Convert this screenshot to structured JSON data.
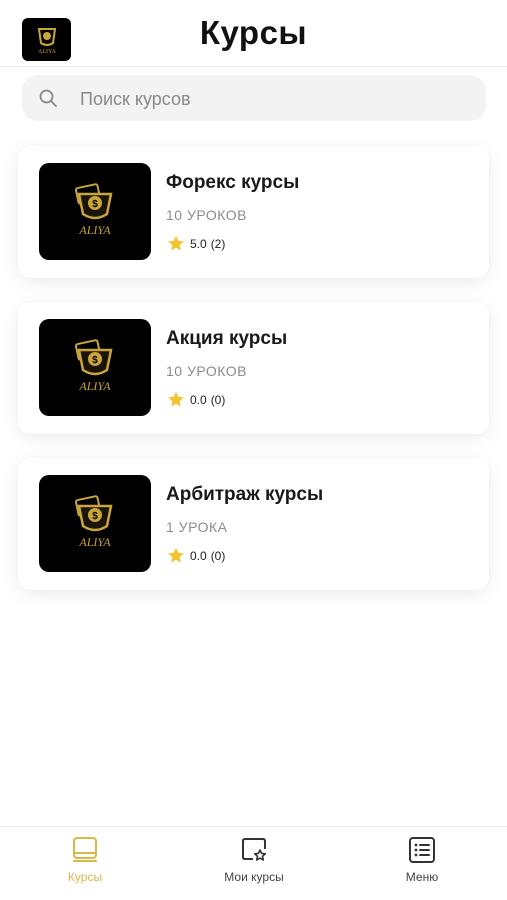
{
  "header": {
    "title": "Курсы",
    "logo_text": "ALIYA"
  },
  "search": {
    "placeholder": "Поиск курсов",
    "value": ""
  },
  "courses": [
    {
      "title": "Форекс курсы",
      "lessons": "10 УРОКОВ",
      "rating": "5.0",
      "reviews": "(2)",
      "thumb_text": "ALIYA"
    },
    {
      "title": "Акция курсы",
      "lessons": "10 УРОКОВ",
      "rating": "0.0",
      "reviews": "(0)",
      "thumb_text": "ALIYA"
    },
    {
      "title": "Арбитраж курсы",
      "lessons": "1 УРОКА",
      "rating": "0.0",
      "reviews": "(0)",
      "thumb_text": "ALIYA"
    }
  ],
  "bottom_nav": {
    "items": [
      {
        "label": "Курсы",
        "icon": "book-icon",
        "active": true
      },
      {
        "label": "Мои курсы",
        "icon": "my-courses-icon",
        "active": false
      },
      {
        "label": "Меню",
        "icon": "list-icon",
        "active": false
      }
    ]
  },
  "colors": {
    "accent_gold": "#d9b84a",
    "star": "#f4c430",
    "logo_bg": "#000000"
  }
}
